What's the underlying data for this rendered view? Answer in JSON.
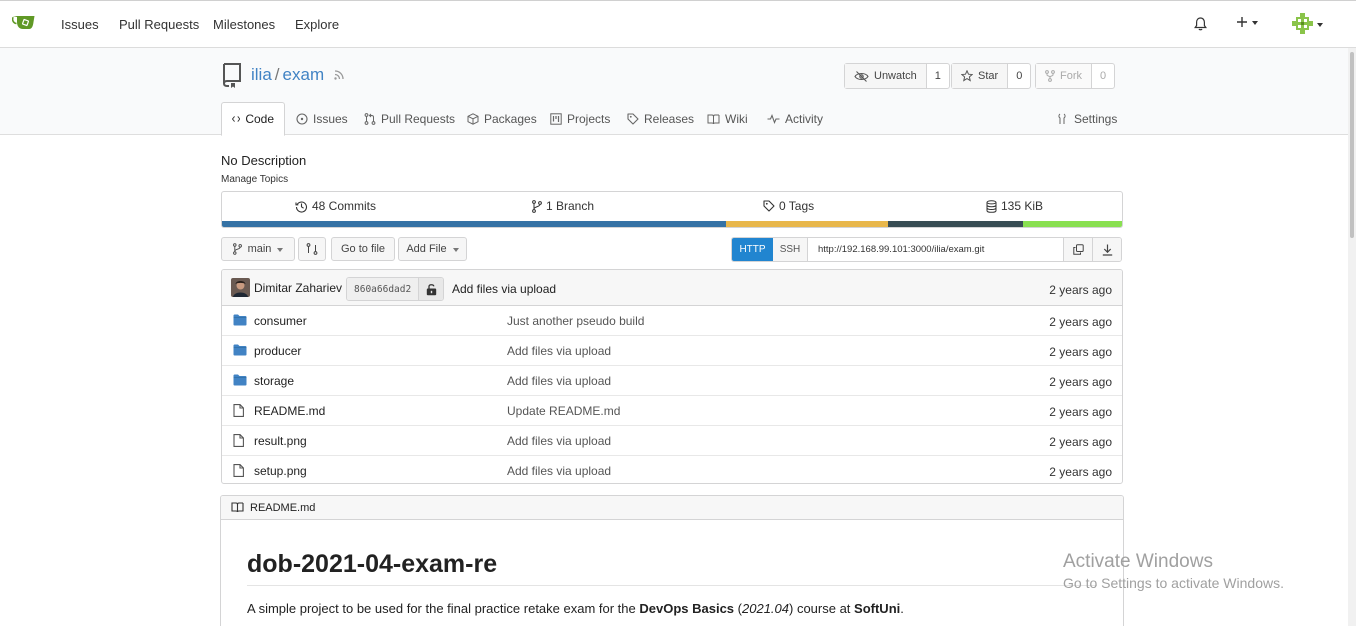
{
  "nav": {
    "links": [
      "Issues",
      "Pull Requests",
      "Milestones",
      "Explore"
    ]
  },
  "repo": {
    "owner": "ilia",
    "separator": "/",
    "name": "exam",
    "unwatch_label": "Unwatch",
    "watch_count": "1",
    "star_label": "Star",
    "star_count": "0",
    "fork_label": "Fork",
    "fork_count": "0"
  },
  "tabs": [
    "Code",
    "Issues",
    "Pull Requests",
    "Packages",
    "Projects",
    "Releases",
    "Wiki",
    "Activity",
    "Settings"
  ],
  "description": "No Description",
  "manage_topics": "Manage Topics",
  "stats": {
    "commits": "48 Commits",
    "branches": "1 Branch",
    "tags": "0 Tags",
    "size": "135 KiB"
  },
  "language_bar": [
    {
      "share": 0.56,
      "color": "#3572A5"
    },
    {
      "share": 0.18,
      "color": "#e8b74b"
    },
    {
      "share": 0.15,
      "color": "#384d54"
    },
    {
      "share": 0.11,
      "color": "#89e051"
    }
  ],
  "toolbar": {
    "branch": "main",
    "go_to_file": "Go to file",
    "add_file": "Add File",
    "http": "HTTP",
    "ssh": "SSH",
    "clone_url": "http://192.168.99.101:3000/ilia/exam.git"
  },
  "latest_commit": {
    "author": "Dimitar Zahariev",
    "sha": "860a66dad2",
    "message": "Add files via upload",
    "age": "2 years ago"
  },
  "files": [
    {
      "name": "consumer",
      "type": "folder",
      "message": "Just another pseudo build",
      "age": "2 years ago"
    },
    {
      "name": "producer",
      "type": "folder",
      "message": "Add files via upload",
      "age": "2 years ago"
    },
    {
      "name": "storage",
      "type": "folder",
      "message": "Add files via upload",
      "age": "2 years ago"
    },
    {
      "name": "README.md",
      "type": "file",
      "message": "Update README.md",
      "age": "2 years ago"
    },
    {
      "name": "result.png",
      "type": "file",
      "message": "Add files via upload",
      "age": "2 years ago"
    },
    {
      "name": "setup.png",
      "type": "file",
      "message": "Add files via upload",
      "age": "2 years ago"
    }
  ],
  "readme": {
    "filename": "README.md",
    "heading": "dob-2021-04-exam-re",
    "p_before": "A simple project to be used for the final practice retake exam for the ",
    "p_bold1": "DevOps Basics",
    "p_mid1": " (",
    "p_italic": "2021.04",
    "p_mid2": ") course at ",
    "p_bold2": "SoftUni",
    "p_end": "."
  },
  "watermark": {
    "line1": "Activate Windows",
    "line2": "Go to Settings to activate Windows."
  }
}
